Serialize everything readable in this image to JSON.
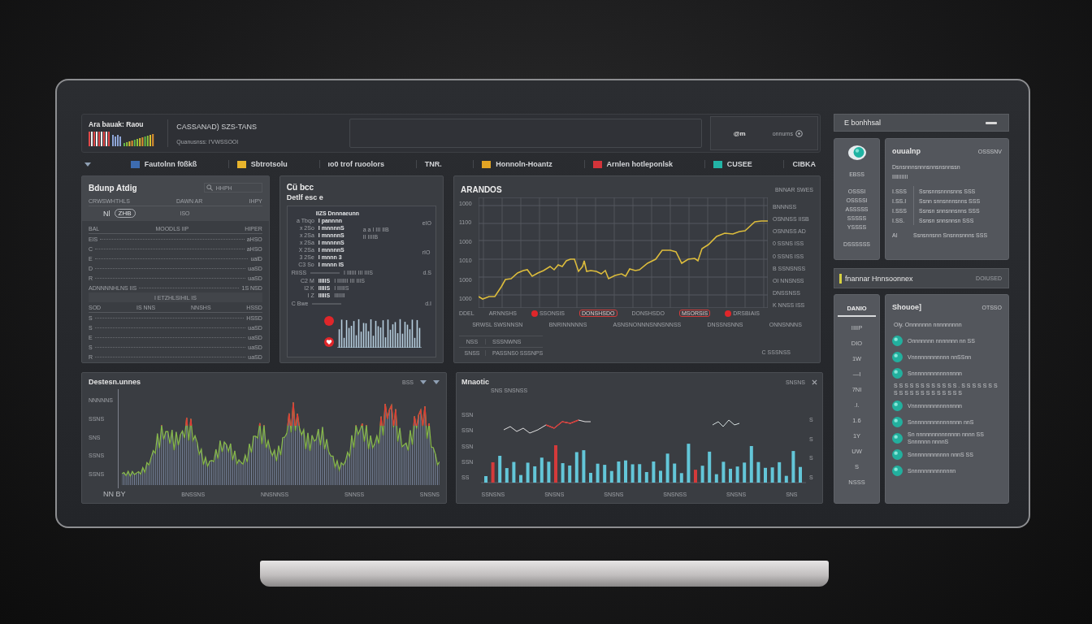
{
  "header": {
    "brand": "Ara bauak: Raou",
    "title": "CASSANAD) SZS-TANS",
    "subtitle": "Quanusnss: I'VWSSOOI",
    "user": "@m",
    "menu": "onnurns"
  },
  "filters": [
    {
      "label": "Fautolnn f0ßkß",
      "color": "#3d6cb0"
    },
    {
      "label": "Sbtrotsolu",
      "color": "#e8b42c"
    },
    {
      "label": "ıo0 trof ruoolors"
    },
    {
      "label": "TNR."
    },
    {
      "label": "Honnoln-Hoantz",
      "color": "#e2a424"
    },
    {
      "label": "Arnlen hotleponlsk",
      "color": "#d3343a"
    },
    {
      "label": "CUSEE",
      "color": "#22b4a6"
    },
    {
      "label": "CIBKA"
    }
  ],
  "ledger": {
    "title": "Bdunp Atdig",
    "search": {
      "placeholder": "HHPH"
    },
    "summary": [
      "CRWSWHTHLS",
      "DAWN AR",
      "IHPY"
    ],
    "badge_prefix": "Nl",
    "badge": "ZHB",
    "note": "ISO",
    "groups": [
      {
        "columns": [
          "BAL",
          "MOODLS IIP",
          "HIPER"
        ],
        "rows": [
          {
            "label": "EIS",
            "value": "aHSO"
          },
          {
            "label": "C",
            "value": "aHSO"
          },
          {
            "label": "E",
            "value": "ualD"
          },
          {
            "label": "D",
            "value": "uaSD"
          },
          {
            "label": "R",
            "value": "uaSD"
          },
          {
            "label": "ADNNNNHLNS IIS",
            "value": "1S NSD"
          }
        ]
      },
      {
        "caption": "I ETZHLSIHIL IS",
        "columns": [
          "SOD",
          "IS NNS",
          "NNSHS",
          "HSSD"
        ],
        "rows": [
          {
            "label": "S",
            "value": "HSSD"
          },
          {
            "label": "S",
            "value": "uaSD"
          },
          {
            "label": "E",
            "value": "uaSD"
          },
          {
            "label": "S",
            "value": "uaSD"
          },
          {
            "label": "R",
            "value": "uaSD"
          }
        ]
      }
    ]
  },
  "details": {
    "title": "Cü bcc",
    "subtitle": "Detlf esc e",
    "caption": "IIZS Dnnnaeunn",
    "rows": [
      {
        "code": "a Tbqo",
        "name": "I pannnn"
      },
      {
        "code": "x 2So",
        "name": "I mnnnnS"
      },
      {
        "code": "x 2Sa",
        "name": "I mnnnnS"
      },
      {
        "code": "x 2Sa",
        "name": "I mnnnnS"
      },
      {
        "code": "X 2Sa",
        "name": "I mnnnnS"
      },
      {
        "code": "3 2Se",
        "name": "I mnnn 3"
      },
      {
        "code": "C3 So",
        "name": "I mnnn IS"
      }
    ],
    "notes": [
      "a a I III IIB",
      "II IIIIB"
    ],
    "side": [
      "eIO",
      "rIO"
    ],
    "section": {
      "label": "RIISS",
      "note": "I IIIIII III IIIS",
      "side": "d.S"
    },
    "entries": [
      {
        "code": "C2 M",
        "name": "IIIIIS",
        "note": "I IIIIIII III IIIS"
      },
      {
        "code": "I2 K",
        "name": "IIIIIS",
        "note": "I IIIIIS"
      },
      {
        "code": "I Z",
        "name": "IIIIIS",
        "note": "IIIIIII"
      }
    ],
    "footer": {
      "label": "C Bwe",
      "side": "d.I"
    }
  },
  "trend": {
    "title": "ARANDOS",
    "action": "BNNAR SWES",
    "y_ticks": [
      "1000",
      "1100",
      "1000",
      "1010",
      "1000",
      "1000"
    ],
    "origin": "DDEL",
    "markers": [
      {
        "label": "ARNNSHS",
        "kind": "plain"
      },
      {
        "label": "SSONSIS",
        "kind": "dot"
      },
      {
        "label": "DONSHSDO",
        "kind": "boxed"
      },
      {
        "label": "DONSHSDO",
        "kind": "plain"
      },
      {
        "label": "MSORSIS",
        "kind": "boxed"
      },
      {
        "label": "DRSBIAIS",
        "kind": "dot"
      }
    ],
    "legend": [
      "BNNNSS",
      "OSNNSS IISB",
      "OSNNSS AD",
      "0 SSNS ISS",
      "0 SSNS ISS",
      "B SSNSNSS",
      "OI NNSNSS",
      "DNSSNSS",
      "K NNSS ISS"
    ],
    "x_labels": [
      "SRWSL SWSNNSN",
      "BNRINNNNNS",
      "ASNSNONNNSNNSNNSS",
      "DNSSNSNNS",
      "ONNSNNNS"
    ],
    "footer": [
      {
        "key": "NSS",
        "value": "SSSNWNS"
      },
      {
        "key": "SNSS",
        "value": "PASSNS0 SSSNPS"
      }
    ],
    "footer_action": "C SSSNSS"
  },
  "waves": {
    "title": "Destesn.unnes",
    "action": "BSS",
    "y_ticks": [
      "NNNNNS",
      "SSNS",
      "SNS",
      "SSNS",
      "SSNS"
    ],
    "x_labels": [
      "NN BY",
      "BNSSNS",
      "NNSNNSS",
      "SNNSS",
      "SNSNS"
    ]
  },
  "bars": {
    "title": "Mnaotic",
    "action": "SNSNS",
    "top_label": "SNS SNSNSS",
    "y_ticks": [
      "SSN",
      "SSN",
      "SSN",
      "SSN",
      "SS"
    ],
    "right_ticks": [
      "S",
      "S",
      "S",
      "S"
    ],
    "x_labels": [
      "SSNSNS",
      "SNSNS",
      "SNSNS",
      "SNSNSS",
      "SNSNS",
      "SNS"
    ]
  },
  "summary": {
    "title": "E bonhhsal"
  },
  "accounts": {
    "items": [
      "EBSS",
      "OSSSI",
      "OSSSSI",
      "ASSSSS",
      "SSSSS",
      "YSSSS",
      "DSSSSSS"
    ],
    "card": {
      "title": "ouualnp",
      "action": "OSSSNV",
      "lines": [
        "Dsnsnnnsnnnsnnsnsnnssn",
        "IIIIIIIIII"
      ],
      "rows": [
        {
          "time": "I.SSS",
          "text": "Ssnsnnsnnnsnns SSS"
        },
        {
          "time": "I.SS.I",
          "text": "Ssnn snnsnnnsnns SSS"
        },
        {
          "time": "I.SSS",
          "text": "Ssnsn snnsnnsnns SSS"
        },
        {
          "time": "I.SS.",
          "text": "Ssnsn snnsnnsn SSS"
        }
      ],
      "footer": {
        "time": "AI",
        "text": "Ssnsnnsnn Snsnnsnnns SSS"
      }
    }
  },
  "activity": {
    "title": "fnannar Hnnsoonnex",
    "action": "DOIUSED",
    "tabs": [
      {
        "label": "DANIO",
        "selected": true
      },
      {
        "label": "IIIIP",
        "selected": false
      },
      {
        "label": "DIO",
        "selected": false
      },
      {
        "label": "1W",
        "selected": false
      },
      {
        "label": "—I",
        "selected": false
      },
      {
        "label": "7NI",
        "selected": false
      },
      {
        "label": ".I.",
        "selected": false
      },
      {
        "label": "1.6",
        "selected": false
      },
      {
        "label": "1Y",
        "selected": false
      },
      {
        "label": "UW",
        "selected": false
      },
      {
        "label": "S",
        "selected": false
      },
      {
        "label": "NSSS",
        "selected": false
      }
    ],
    "list": {
      "title": "Shouoe]",
      "action": "OTSSO",
      "items": [
        {
          "kind": "text",
          "text": "Oly. Onnnnnnn nnnnnnnnn"
        },
        {
          "kind": "icon",
          "text": "Onnnnnnn nnnnnnn nn SS"
        },
        {
          "kind": "icon",
          "text": "Vnnnnnnnnnnnn nnSSnn"
        },
        {
          "kind": "icon",
          "text": "Snnnnnnnnnnnnnnnn"
        },
        {
          "kind": "text",
          "text": "S S S S S S S S S S S S . S S S S S S S S S S S S S S S S S S S S"
        },
        {
          "kind": "icon",
          "text": "Vnnnnnnnnnnnnnnnn"
        },
        {
          "kind": "icon",
          "text": "Snnnnnnnnnnnnnnnn nnS"
        },
        {
          "kind": "icon",
          "text": "Sn nnnnnnnnnnnnnn nnnn SS Snnnnnn nnnnS"
        },
        {
          "kind": "icon",
          "text": "Snnnnnnnnnnnn nnnS SS"
        },
        {
          "kind": "icon",
          "text": "Snnnnnnnnnnnnnn"
        }
      ]
    }
  }
}
